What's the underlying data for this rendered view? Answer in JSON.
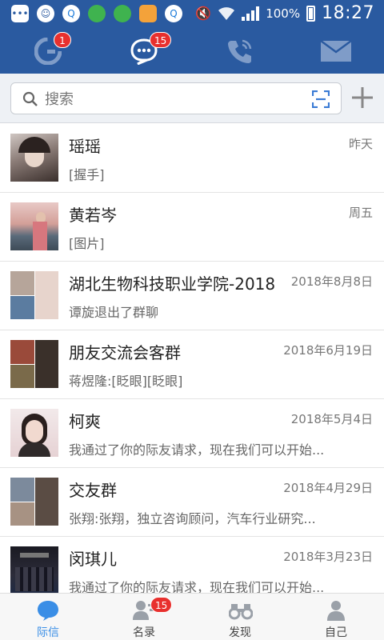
{
  "status_bar": {
    "battery": "100%",
    "time": "18:27"
  },
  "top_tabs": [
    {
      "icon": "contacts-logo-icon",
      "badge": "1"
    },
    {
      "icon": "chat-icon",
      "badge": "15"
    },
    {
      "icon": "phone-icon",
      "badge": ""
    },
    {
      "icon": "mail-icon",
      "badge": ""
    }
  ],
  "search": {
    "placeholder": "搜索"
  },
  "conversations": [
    {
      "name": "瑶瑶",
      "time": "昨天",
      "preview": "[握手]"
    },
    {
      "name": "黄若岑",
      "time": "周五",
      "preview": "[图片]"
    },
    {
      "name": "湖北生物科技职业学院-2018",
      "time": "2018年8月8日",
      "preview": "谭旋退出了群聊"
    },
    {
      "name": "朋友交流会客群",
      "time": "2018年6月19日",
      "preview": "蒋煜隆:[眨眼][眨眼]"
    },
    {
      "name": "柯爽",
      "time": "2018年5月4日",
      "preview": "我通过了你的际友请求，现在我们可以开始..."
    },
    {
      "name": "交友群",
      "time": "2018年4月29日",
      "preview": "张翔:张翔，独立咨询顾问，汽车行业研究..."
    },
    {
      "name": "闵琪儿",
      "time": "2018年3月23日",
      "preview": "我通过了你的际友请求，现在我们可以开始..."
    }
  ],
  "bottom_nav": [
    {
      "label": "际信",
      "icon": "chat-bubble-icon",
      "badge": ""
    },
    {
      "label": "名录",
      "icon": "directory-icon",
      "badge": "15"
    },
    {
      "label": "发现",
      "icon": "binoculars-icon",
      "badge": ""
    },
    {
      "label": "自己",
      "icon": "person-icon",
      "badge": ""
    }
  ],
  "colors": {
    "header_blue": "#2a5aa0",
    "active_blue": "#3a8ee6",
    "badge_red": "#e8302e"
  }
}
